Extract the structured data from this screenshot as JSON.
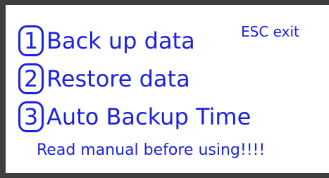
{
  "menu": {
    "items": [
      {
        "number": "1",
        "label": "Back up data"
      },
      {
        "number": "2",
        "label": "Restore data"
      },
      {
        "number": "3",
        "label": "Auto Backup Time"
      }
    ]
  },
  "esc_label": "ESC exit",
  "notice": "Read manual before using!!!!",
  "colors": {
    "text": "#1a22e0",
    "background": "#ffffff",
    "bezel": "#3f3f3f"
  }
}
